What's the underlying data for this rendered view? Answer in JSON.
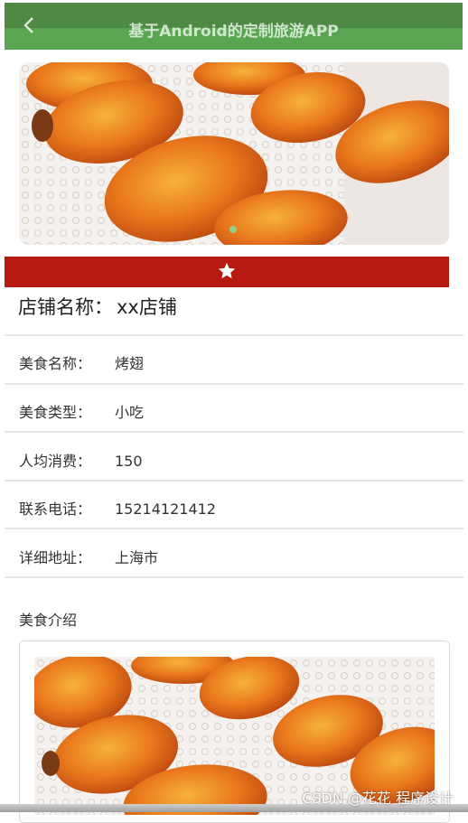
{
  "app": {
    "title": "基于Android的定制旅游APP",
    "back_icon": "chevron-left-icon",
    "header_color": "#5aa552"
  },
  "banner": {
    "image": "roast-chicken-wings-photo",
    "indicator_color": "#8fd18c"
  },
  "favorite_bar": {
    "icon": "star-icon",
    "color": "#b71a10"
  },
  "shop": {
    "label": "店铺名称：",
    "name": "xx店铺"
  },
  "details": [
    {
      "label": "美食名称：",
      "value": "烤翅"
    },
    {
      "label": "美食类型：",
      "value": "小吃"
    },
    {
      "label": "人均消费：",
      "value": "150"
    },
    {
      "label": "联系电话：",
      "value": "15214121412"
    },
    {
      "label": "详细地址：",
      "value": "上海市"
    }
  ],
  "intro": {
    "title": "美食介绍",
    "image": "roast-chicken-wings-photo"
  },
  "watermark": "CSDN @花花 程序设计"
}
